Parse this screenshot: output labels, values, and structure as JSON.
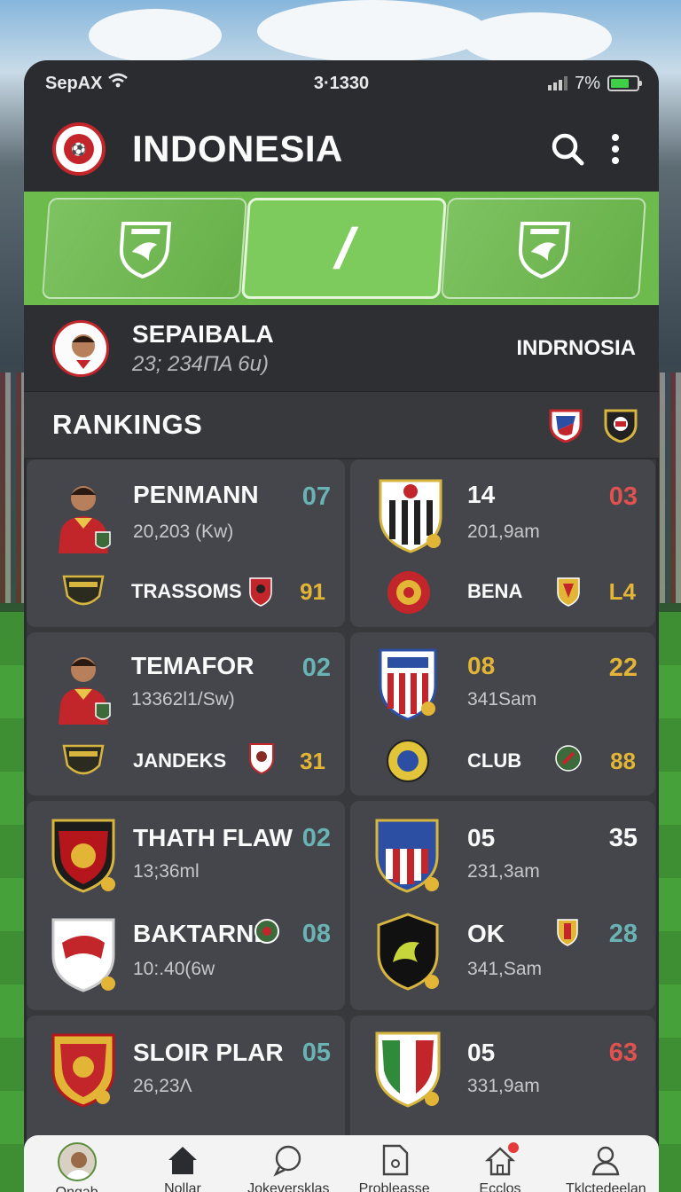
{
  "status_bar": {
    "carrier": "SepAX",
    "time": "3·1330",
    "battery": "7%",
    "battery_level": 0.7
  },
  "header": {
    "title": "INDONESIA",
    "crest_icon": "team-crest-icon",
    "search_icon": "search-icon",
    "more_icon": "more-vertical-icon"
  },
  "match_strip": {
    "center_label": "/",
    "left_icon": "eagle-shield-icon",
    "right_icon": "eagle-shield-icon"
  },
  "player": {
    "name": "SEPAIBALA",
    "subtitle": "23; 234ΠA 6u)",
    "country": "INDRNOSIA"
  },
  "rankings": {
    "title": "RANKINGS",
    "flag_icons": [
      "flag-shield-icon",
      "club-shield-icon"
    ]
  },
  "cards": [
    {
      "title": "PENMANN",
      "subtitle": "20,203 (Kw)",
      "title_num": "07",
      "row_label": "TRASSOMS",
      "row_num": "91"
    },
    {
      "title": "14",
      "subtitle": "201,9am",
      "title_num": "03",
      "row_label": "BENA",
      "row_num": "L4"
    },
    {
      "title": "TEMAFOR",
      "subtitle": "13362l1/Sw)",
      "title_num": "02",
      "row_label": "JANDEKS",
      "row_num": "31"
    },
    {
      "title": "08",
      "subtitle": "341Sam",
      "title_num": "22",
      "row_label": "CLUB",
      "row_num": "88"
    },
    {
      "title": "THATH FLAW",
      "subtitle": "13;36ml",
      "title_num": "02",
      "row_label": "BAKTARNE",
      "row_sub": "10:.40(6w",
      "row_num": "08"
    },
    {
      "title": "05",
      "subtitle": "231,3am",
      "title_num": "35",
      "row_label": "OK",
      "row_sub": "341,Sam",
      "row_num": "28"
    },
    {
      "title": "SLOIR PLAR",
      "subtitle": "26,23Λ",
      "title_num": "05"
    },
    {
      "title": "05",
      "subtitle": "331,9am",
      "title_num": "63"
    }
  ],
  "tabs": [
    {
      "label": "Ongab",
      "icon": "profile-avatar-icon"
    },
    {
      "label": "Nollar",
      "icon": "home-icon"
    },
    {
      "label": "Jokeversklas",
      "icon": "chat-search-icon"
    },
    {
      "label": "Probleasse",
      "icon": "document-icon"
    },
    {
      "label": "Ecclos",
      "icon": "notification-home-icon"
    },
    {
      "label": "Tklctedeelan",
      "icon": "user-icon"
    }
  ],
  "colors": {
    "accent_green": "#6dbb4d",
    "panel": "#2b2c30",
    "card": "#45464b",
    "teal": "#6ab3b5",
    "red": "#e0524f",
    "gold": "#e2b536"
  }
}
